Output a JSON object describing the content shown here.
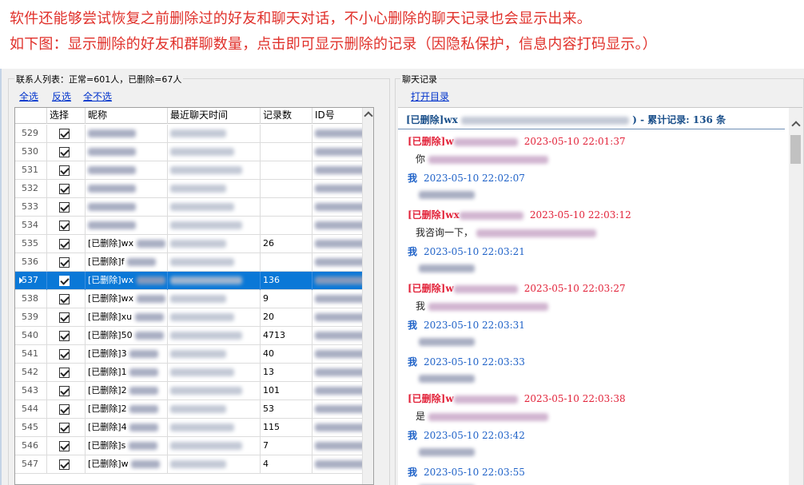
{
  "annotation": {
    "line1": "软件还能够尝试恢复之前删除过的好友和聊天对话，不小心删除的聊天记录也会显示出来。",
    "line2": "如下图：显示删除的好友和群聊数量，点击即可显示删除的记录（因隐私保护，信息内容打码显示。）"
  },
  "contacts_panel": {
    "title": "联系人列表：正常=601人，已删除=67人",
    "select_all": "全选",
    "invert": "反选",
    "select_none": "全不选",
    "columns": [
      "选择",
      "昵称",
      "最近聊天时间",
      "记录数",
      "ID号"
    ],
    "rows": [
      {
        "num": "529",
        "name": "",
        "count": ""
      },
      {
        "num": "530",
        "name": "",
        "count": ""
      },
      {
        "num": "531",
        "name": "",
        "count": ""
      },
      {
        "num": "532",
        "name": "",
        "count": ""
      },
      {
        "num": "533",
        "name": "",
        "count": ""
      },
      {
        "num": "534",
        "name": "",
        "count": ""
      },
      {
        "num": "535",
        "name": "[已删除]wx",
        "count": "26"
      },
      {
        "num": "536",
        "name": "[已删除]f",
        "count": ""
      },
      {
        "num": "537",
        "name": "[已删除]wx",
        "count": "136",
        "selected": true
      },
      {
        "num": "538",
        "name": "[已删除]wx",
        "count": "9"
      },
      {
        "num": "539",
        "name": "[已删除]xu",
        "count": "20"
      },
      {
        "num": "540",
        "name": "[已删除]50",
        "count": "4713"
      },
      {
        "num": "541",
        "name": "[已删除]3",
        "count": "40"
      },
      {
        "num": "542",
        "name": "[已删除]1",
        "count": "13"
      },
      {
        "num": "543",
        "name": "[已删除]2",
        "count": "101"
      },
      {
        "num": "544",
        "name": "[已删除]2",
        "count": "53"
      },
      {
        "num": "545",
        "name": "[已删除]4",
        "count": "115"
      },
      {
        "num": "546",
        "name": "[已删除]s",
        "count": "7"
      },
      {
        "num": "547",
        "name": "[已删除]w",
        "count": "4"
      }
    ]
  },
  "chat_panel": {
    "title": "聊天记录",
    "open_dir": "打开目录",
    "header_prefix": "[已删除]wx",
    "header_suffix": ") - 累计记录: 136 条",
    "messages": [
      {
        "who": "[已删除]w",
        "time": "2023-05-10 22:01:37",
        "deleted": true,
        "text": "你"
      },
      {
        "who": "我",
        "time": "2023-05-10 22:02:07",
        "deleted": false,
        "text": ""
      },
      {
        "who": "[已删除]wx",
        "time": "2023-05-10 22:03:12",
        "deleted": true,
        "text": "我咨询一下，"
      },
      {
        "who": "我",
        "time": "2023-05-10 22:03:21",
        "deleted": false,
        "text": ""
      },
      {
        "who": "[已删除]w",
        "time": "2023-05-10 22:03:27",
        "deleted": true,
        "text": "我"
      },
      {
        "who": "我",
        "time": "2023-05-10 22:03:31",
        "deleted": false,
        "text": ""
      },
      {
        "who": "我",
        "time": "2023-05-10 22:03:33",
        "deleted": false,
        "text": ""
      },
      {
        "who": "[已删除]w",
        "time": "2023-05-10 22:03:38",
        "deleted": true,
        "text": "是"
      },
      {
        "who": "我",
        "time": "2023-05-10 22:03:42",
        "deleted": false,
        "text": ""
      },
      {
        "who": "我",
        "time": "2023-05-10 22:03:55",
        "deleted": false,
        "text": ""
      }
    ]
  }
}
